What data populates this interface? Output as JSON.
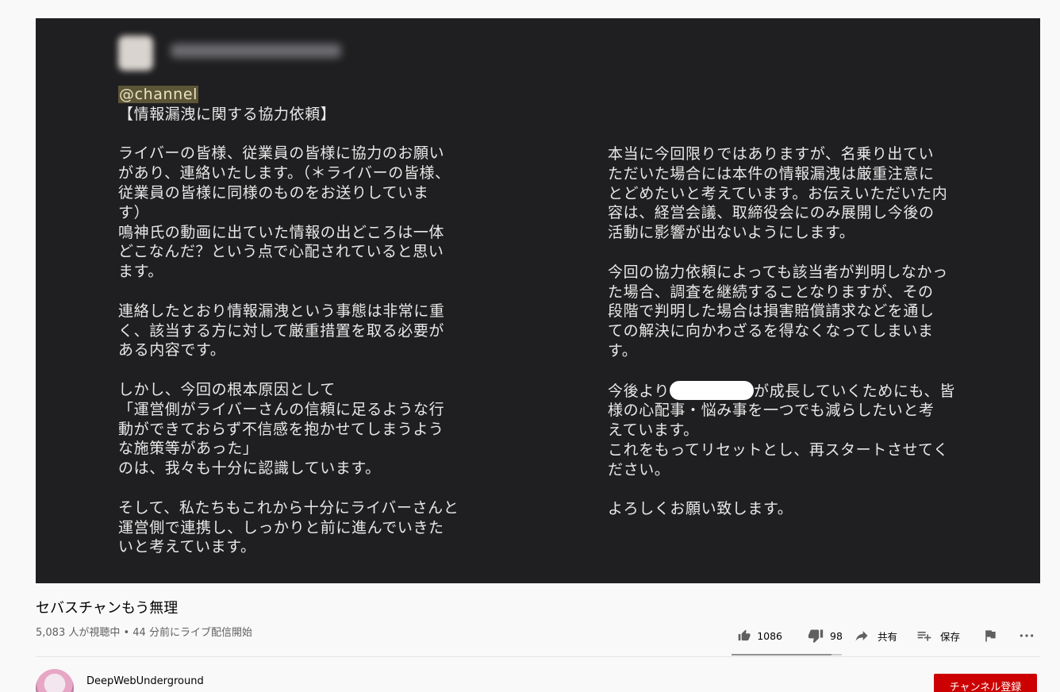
{
  "player": {
    "mention": "@channel",
    "left_column": [
      "【情報漏洩に関する協力依頼】",
      "",
      "ライバーの皆様、従業員の皆様に協力のお願い",
      "があり、連絡いたします。（＊ライバーの皆様、",
      "従業員の皆様に同様のものをお送りしていま",
      "す）",
      "鳴神氏の動画に出ていた情報の出どころは一体",
      "どこなんだ？という点で心配されていると思い",
      "ます。",
      "",
      "連絡したとおり情報漏洩という事態は非常に重",
      "く、該当する方に対して厳重措置を取る必要が",
      "ある内容です。",
      "",
      "しかし、今回の根本原因として",
      "「運営側がライバーさんの信頼に足るような行",
      "動ができておらず不信感を抱かせてしまうよう",
      "な施策等があった」",
      "のは、我々も十分に認識しています。",
      "",
      "そして、私たちもこれから十分にライバーさんと",
      "運営側で連携し、しっかりと前に進んでいきた",
      "いと考えています。"
    ],
    "right_column_top": [
      "本当に今回限りではありますが、名乗り出てい",
      "ただいた場合には本件の情報漏洩は厳重注意に",
      "とどめたいと考えています。お伝えいただいた内",
      "容は、経営会議、取締役会にのみ展開し今後の",
      "活動に影響が出ないようにします。",
      "",
      "今回の協力依頼によっても該当者が判明しなかっ",
      "た場合、調査を継続することなりますが、その",
      "段階で判明した場合は損害賠償請求などを通し",
      "ての解決に向かわざるを得なくなってしまいま",
      "す。",
      ""
    ],
    "redacted_line_prefix": "今後より",
    "redacted_line_suffix": "が成長していくためにも、皆",
    "right_column_bottom": [
      "様の心配事・悩み事を一つでも減らしたいと考",
      "えています。",
      "これをもってリセットとし、再スタートさせてく",
      "ださい。",
      "",
      "よろしくお願い致します。"
    ]
  },
  "video": {
    "title": "セバスチャンもう無理",
    "meta": "5,083 人が視聴中 • 44 分前にライブ配信開始"
  },
  "actions": {
    "likes": "1086",
    "dislikes": "98",
    "share": "共有",
    "save": "保存"
  },
  "channel": {
    "name": "DeepWebUnderground",
    "subscribe": "チャンネル登録"
  },
  "colors": {
    "player_bg": "#1f1f21",
    "subscribe_red": "#cc0000",
    "mention_bg": "#5c5636"
  },
  "icons": [
    "like-icon",
    "dislike-icon",
    "share-icon",
    "save-playlist-icon",
    "flag-icon",
    "more-icon"
  ]
}
